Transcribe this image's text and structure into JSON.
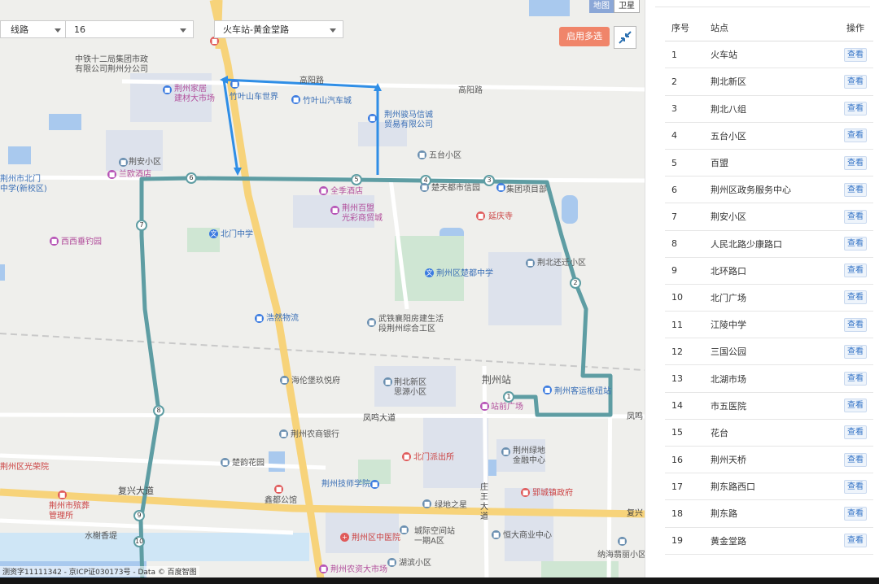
{
  "controls": {
    "type_select": "线路",
    "line_select": "16",
    "route_select": "火车站-黄金堂路",
    "multi_select_button": "启用多选",
    "map_type_map": "地图",
    "map_type_satellite": "卫星"
  },
  "map": {
    "roads": [
      "高阳路",
      "高阳路",
      "凤鸣大道",
      "复兴大道",
      "复兴",
      "凤鸣",
      "庄王大道"
    ],
    "pois": {
      "zhongtie": "中铁十二局集团市政\n有限公司荆州分公司",
      "jiaju": "荆州家居\n建材大市场",
      "zhuyeshan_car": "竹叶山车世界",
      "zhuyeshan_city": "竹叶山汽车城",
      "junma": "荆州骏马信诚\n贸易有限公司",
      "wutai": "五台小区",
      "jingan": "荆安小区",
      "lanou": "兰欧酒店",
      "beimen_school": "荆州市北门\n中学(新校区)",
      "quanji": "全季酒店",
      "baimeng": "荆州百盟\n光彩商贸城",
      "chutian": "楚天都市信园",
      "jituan": "集团项目部",
      "yanqing": "延庆寺",
      "xixi": "西西垂钓园",
      "beimen_zhongxue": "北门中学",
      "jingbei": "荆北还迁小区",
      "chudu": "荆州区楚都中学",
      "haoran": "浩然物流",
      "wutie": "武铁襄阳房建生活\n段荆州综合工区",
      "jingzhou_station": "荆州站",
      "keyun": "荆州客运枢纽站",
      "zhanqian": "站前广场",
      "xinqu": "荆北新区\n思源小区",
      "hailun": "海伦堡玖悦府",
      "nongshang": "荆州农商银行",
      "beimen_police": "北门派出所",
      "lvdi": "荆州绿地\n金融中心",
      "chuhuang": "楚韵花园",
      "guangrong": "荆州区光荣院",
      "binzang": "荆州市殡葬\n管理所",
      "jishu": "荆州技师学院",
      "xindu": "鑫都公馆",
      "yingcheng": "郢城镇政府",
      "lvdi_star": "绿地之星",
      "shuixie": "水榭香堤",
      "zhongyi": "荆州区中医院",
      "chengji": "城际空间站\n一期A区",
      "hengda": "恒大商业中心",
      "binhu": "湖滨小区",
      "nongzi": "荆州农资大市场",
      "nahai": "纳海翡丽小区",
      "railway": "火车站"
    },
    "route_stop_markers": [
      "1",
      "2",
      "3",
      "4",
      "5",
      "6",
      "7",
      "8",
      "9",
      "10"
    ],
    "copyright": "测资字11111342 - 京ICP证030173号 - Data © 百度智图"
  },
  "table": {
    "headers": [
      "序号",
      "站点",
      "操作"
    ],
    "rows": [
      {
        "no": "1",
        "stop": "火车站",
        "action": "查看"
      },
      {
        "no": "2",
        "stop": "荆北新区",
        "action": "查看"
      },
      {
        "no": "3",
        "stop": "荆北八组",
        "action": "查看"
      },
      {
        "no": "4",
        "stop": "五台小区",
        "action": "查看"
      },
      {
        "no": "5",
        "stop": "百盟",
        "action": "查看"
      },
      {
        "no": "6",
        "stop": "荆州区政务服务中心",
        "action": "查看"
      },
      {
        "no": "7",
        "stop": "荆安小区",
        "action": "查看"
      },
      {
        "no": "8",
        "stop": "人民北路少康路口",
        "action": "查看"
      },
      {
        "no": "9",
        "stop": "北环路口",
        "action": "查看"
      },
      {
        "no": "10",
        "stop": "北门广场",
        "action": "查看"
      },
      {
        "no": "11",
        "stop": "江陵中学",
        "action": "查看"
      },
      {
        "no": "12",
        "stop": "三国公园",
        "action": "查看"
      },
      {
        "no": "13",
        "stop": "北湖市场",
        "action": "查看"
      },
      {
        "no": "14",
        "stop": "市五医院",
        "action": "查看"
      },
      {
        "no": "15",
        "stop": "花台",
        "action": "查看"
      },
      {
        "no": "16",
        "stop": "荆州天桥",
        "action": "查看"
      },
      {
        "no": "17",
        "stop": "荆东路西口",
        "action": "查看"
      },
      {
        "no": "18",
        "stop": "荆东路",
        "action": "查看"
      },
      {
        "no": "19",
        "stop": "黄金堂路",
        "action": "查看"
      }
    ]
  },
  "colors": {
    "route_line": "#5e9da3",
    "highlight_line": "#2f8ee6",
    "main_road": "#f7d37a",
    "multi_button": "#f0856a",
    "water": "#a9c9ee",
    "green": "#cfe6d3"
  }
}
